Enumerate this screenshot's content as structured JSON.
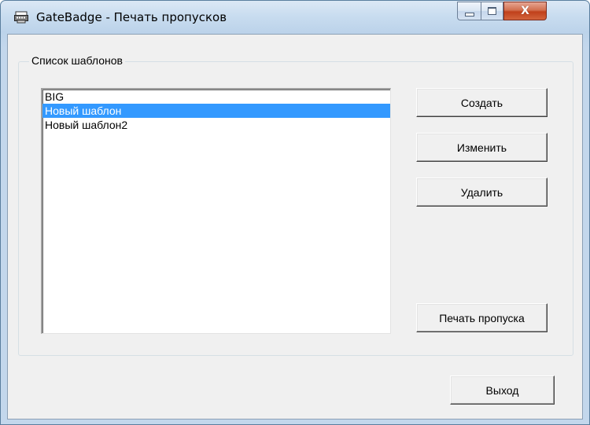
{
  "window": {
    "title": "GateBadge - Печать пропусков",
    "close_glyph": "X"
  },
  "group": {
    "legend": "Список шаблонов"
  },
  "templates": {
    "items": [
      "BIG",
      "Новый шаблон",
      "Новый шаблон2"
    ],
    "selected_index": 1
  },
  "buttons": {
    "create": "Создать",
    "edit": "Изменить",
    "delete": "Удалить",
    "print": "Печать пропуска",
    "exit": "Выход"
  },
  "colors": {
    "selection": "#3399ff",
    "client_background": "#f0f0f0",
    "close_button": "#c0401b"
  },
  "icons": {
    "app": "badge-printer-icon",
    "minimize": "minimize-icon",
    "maximize": "maximize-icon",
    "close": "close-icon"
  }
}
